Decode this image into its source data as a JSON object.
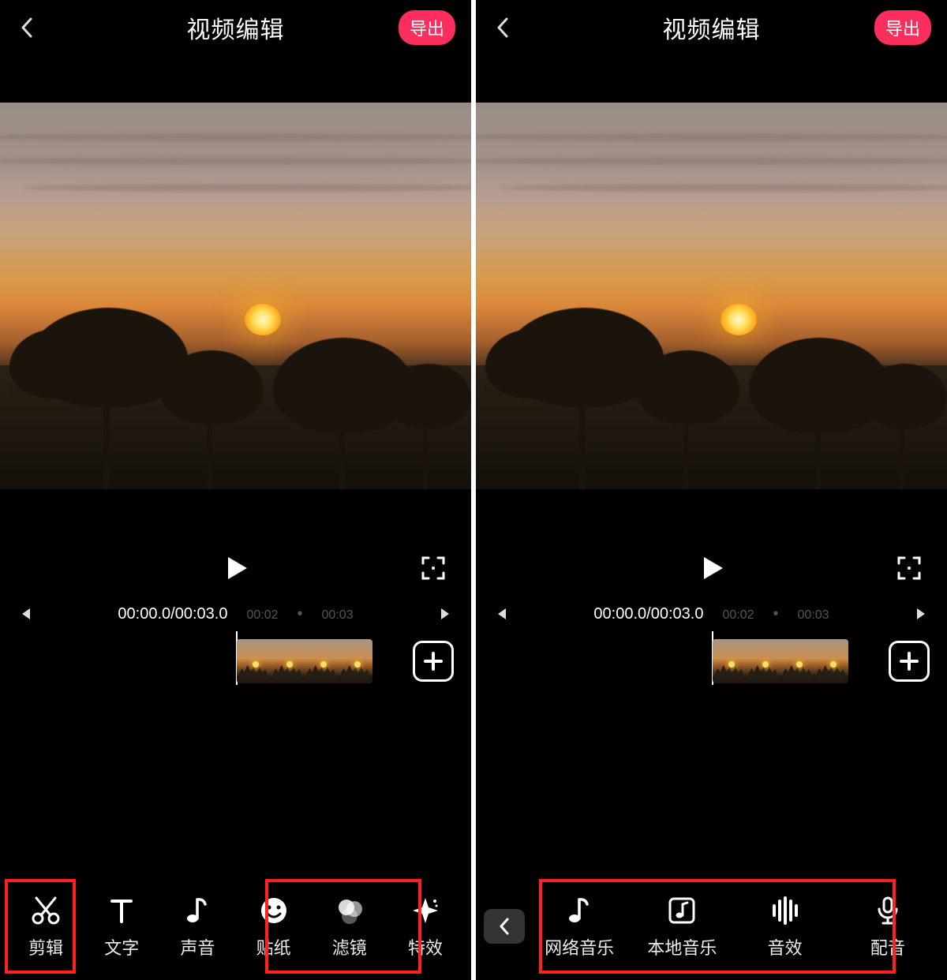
{
  "header": {
    "title": "视频编辑",
    "export_label": "导出"
  },
  "timeline": {
    "current": "00:00.0",
    "total": "00:03.0",
    "tick1": "00:02",
    "tick2": "00:03"
  },
  "left_toolbar": [
    {
      "id": "edit",
      "label": "剪辑",
      "icon": "scissors-icon"
    },
    {
      "id": "text",
      "label": "文字",
      "icon": "text-icon"
    },
    {
      "id": "sound",
      "label": "声音",
      "icon": "music-note-icon"
    },
    {
      "id": "sticker",
      "label": "贴纸",
      "icon": "smiley-icon"
    },
    {
      "id": "filter",
      "label": "滤镜",
      "icon": "overlap-circles-icon"
    },
    {
      "id": "effect",
      "label": "特效",
      "icon": "magic-wand-icon"
    }
  ],
  "right_toolbar": [
    {
      "id": "online_music",
      "label": "网络音乐",
      "icon": "music-note-icon"
    },
    {
      "id": "local_music",
      "label": "本地音乐",
      "icon": "music-frame-icon"
    },
    {
      "id": "sfx",
      "label": "音效",
      "icon": "waveform-icon"
    },
    {
      "id": "voiceover",
      "label": "配音",
      "icon": "microphone-icon"
    }
  ],
  "colors": {
    "export_bg": "#fb2e5e",
    "annotation": "#ff2020"
  }
}
